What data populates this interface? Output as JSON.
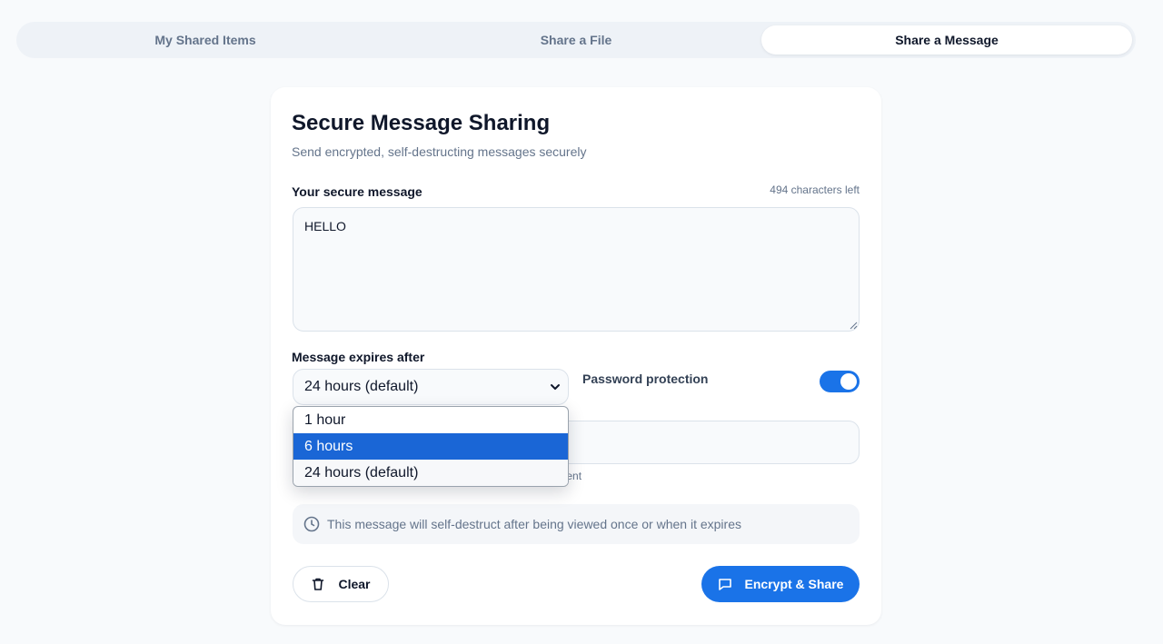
{
  "tabs": [
    {
      "label": "My Shared Items"
    },
    {
      "label": "Share a File"
    },
    {
      "label": "Share a Message"
    }
  ],
  "active_tab": "Share a Message",
  "card": {
    "title": "Secure Message Sharing",
    "subtitle": "Send encrypted, self-destructing messages securely"
  },
  "message": {
    "label": "Your secure message",
    "chars_left": "494 characters left",
    "value": "HELLO"
  },
  "expiry": {
    "label": "Message expires after",
    "selected": "24 hours (default)",
    "options": [
      "1 hour",
      "6 hours",
      "24 hours (default)"
    ],
    "highlighted": "6 hours"
  },
  "password": {
    "label": "Password protection",
    "enabled": true,
    "hint_visible": "pient"
  },
  "info": {
    "text": "This message will self-destruct after being viewed once or when it expires"
  },
  "buttons": {
    "clear": "Clear",
    "share": "Encrypt & Share"
  },
  "colors": {
    "accent": "#1a73e8",
    "highlight": "#1a66d6"
  }
}
